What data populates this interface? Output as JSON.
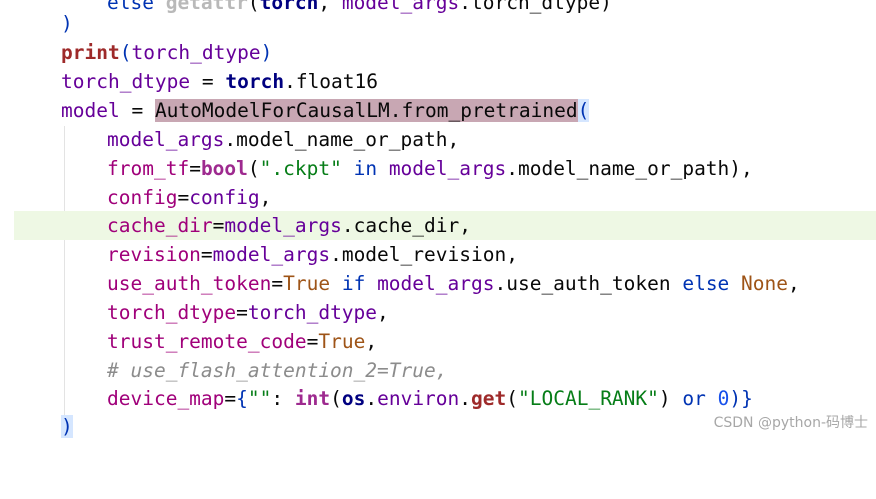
{
  "code_lines": [
    {
      "indent": 2,
      "segments": [
        "else ",
        "getattr",
        "(",
        "torch",
        ", ",
        "model_args",
        ".",
        "torch_dtype",
        ")"
      ]
    },
    {
      "indent": 0,
      "segments": [
        ")"
      ]
    },
    {
      "indent": 0,
      "segments": [
        "print",
        "(",
        "torch_dtype",
        ")"
      ]
    },
    {
      "indent": 0,
      "segments": [
        "torch_dtype",
        " = ",
        "torch",
        ".",
        "float16"
      ]
    },
    {
      "indent": 0,
      "segments": [
        "model",
        " = ",
        "AutoModelForCausalLM",
        ".",
        "from_pretrained",
        "("
      ]
    },
    {
      "indent": 1,
      "segments": [
        "model_args",
        ".",
        "model_name_or_path",
        ","
      ]
    },
    {
      "indent": 1,
      "segments": [
        "from_tf",
        "=",
        "bool",
        "(",
        "\".ckpt\"",
        " in ",
        "model_args",
        ".",
        "model_name_or_path",
        "),"
      ]
    },
    {
      "indent": 1,
      "segments": [
        "config",
        "=",
        "config",
        ","
      ]
    },
    {
      "indent": 1,
      "segments": [
        "cache_dir",
        "=",
        "model_args",
        ".",
        "cache_dir",
        ","
      ]
    },
    {
      "indent": 1,
      "segments": [
        "revision",
        "=",
        "model_args",
        ".",
        "model_revision",
        ","
      ]
    },
    {
      "indent": 1,
      "segments": [
        "use_auth_token",
        "=",
        "True",
        " if ",
        "model_args",
        ".",
        "use_auth_token",
        " else ",
        "None",
        ","
      ]
    },
    {
      "indent": 1,
      "segments": [
        "torch_dtype",
        "=",
        "torch_dtype",
        ","
      ]
    },
    {
      "indent": 1,
      "segments": [
        "trust_remote_code",
        "=",
        "True",
        ","
      ]
    },
    {
      "indent": 1,
      "segments": [
        "# use_flash_attention_2=True,"
      ]
    },
    {
      "indent": 1,
      "segments": [
        "device_map",
        "=",
        "{",
        "\"\"",
        ": ",
        "int",
        "(",
        "os",
        ".",
        "environ",
        ".",
        "get",
        "(",
        "\"LOCAL_RANK\"",
        ") ",
        "or",
        " ",
        "0",
        ")}"
      ]
    },
    {
      "indent": 0,
      "segments": [
        ")"
      ]
    }
  ],
  "caret_line": 9,
  "watermark": "CSDN @python-码博士"
}
